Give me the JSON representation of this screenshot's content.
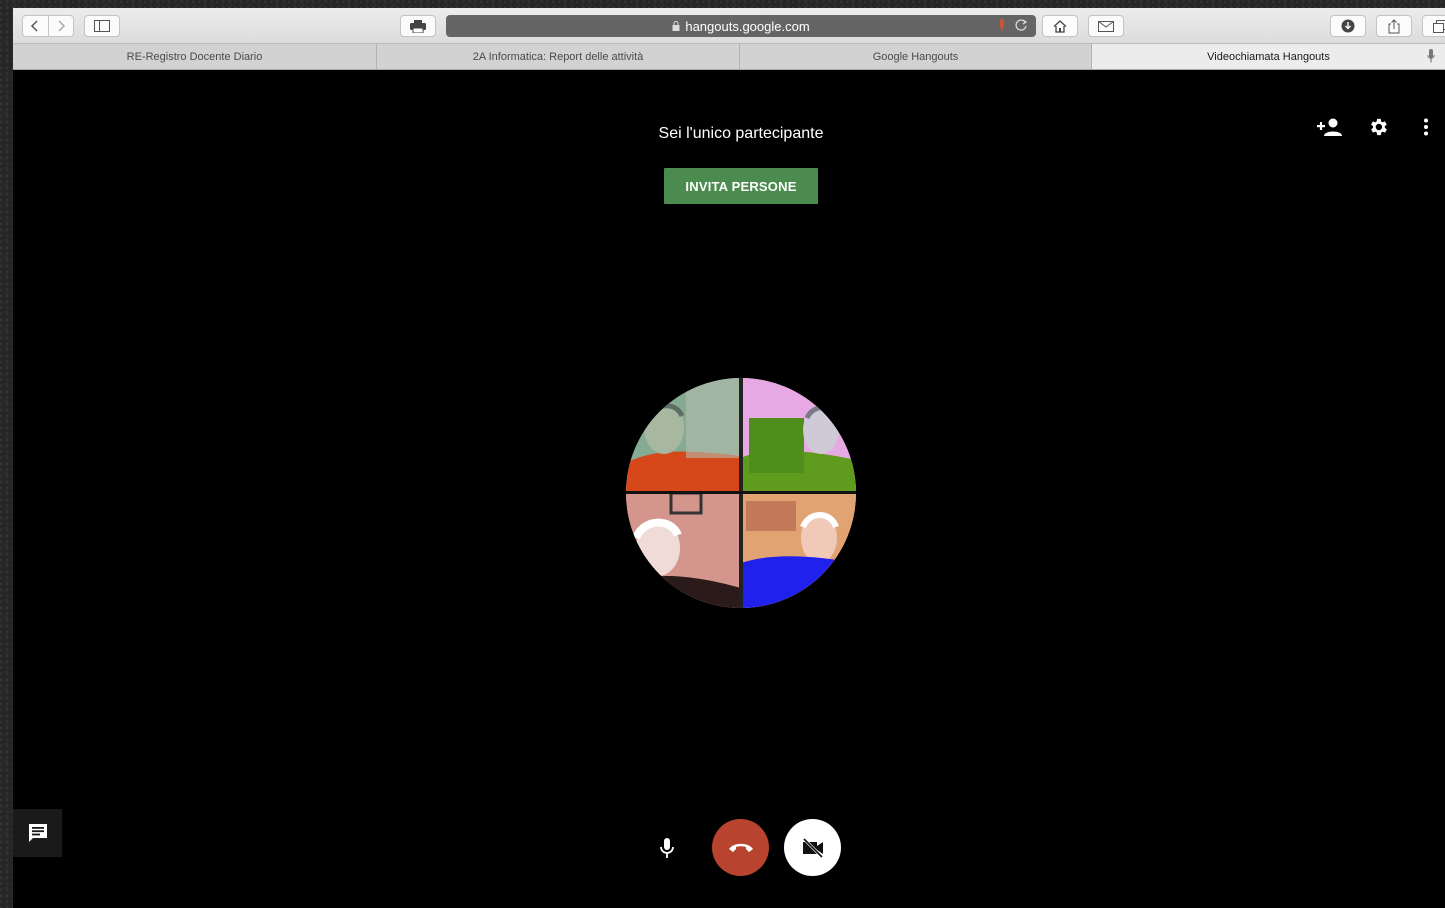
{
  "browser": {
    "url": "hangouts.google.com",
    "icons": {
      "back": "chevron-left-icon",
      "forward": "chevron-right-icon",
      "sidebar": "sidebar-icon",
      "print": "printer-icon",
      "lock": "lock-icon",
      "mic": "microphone-icon",
      "reload": "reload-icon",
      "home": "home-icon",
      "mail": "mail-icon",
      "download": "download-icon",
      "share": "share-icon",
      "tabs": "tabs-icon"
    }
  },
  "tabs": [
    {
      "label": "RE-Registro Docente Diario",
      "active": false
    },
    {
      "label": "2A Informatica: Report delle attività",
      "active": false
    },
    {
      "label": "Google Hangouts",
      "active": false
    },
    {
      "label": "Videochiamata Hangouts",
      "active": true
    }
  ],
  "call": {
    "status_text": "Sei l'unico partecipante",
    "invite_label": "INVITA PERSONE",
    "top_icons": [
      "add-person-icon",
      "settings-icon",
      "more-vert-icon"
    ],
    "controls": [
      "microphone-icon",
      "hangup-icon",
      "camera-off-icon"
    ],
    "chat_icon": "chat-icon",
    "colors": {
      "invite_bg": "#4c8b4f",
      "hangup_bg": "#b8432e",
      "background": "#000000"
    }
  }
}
